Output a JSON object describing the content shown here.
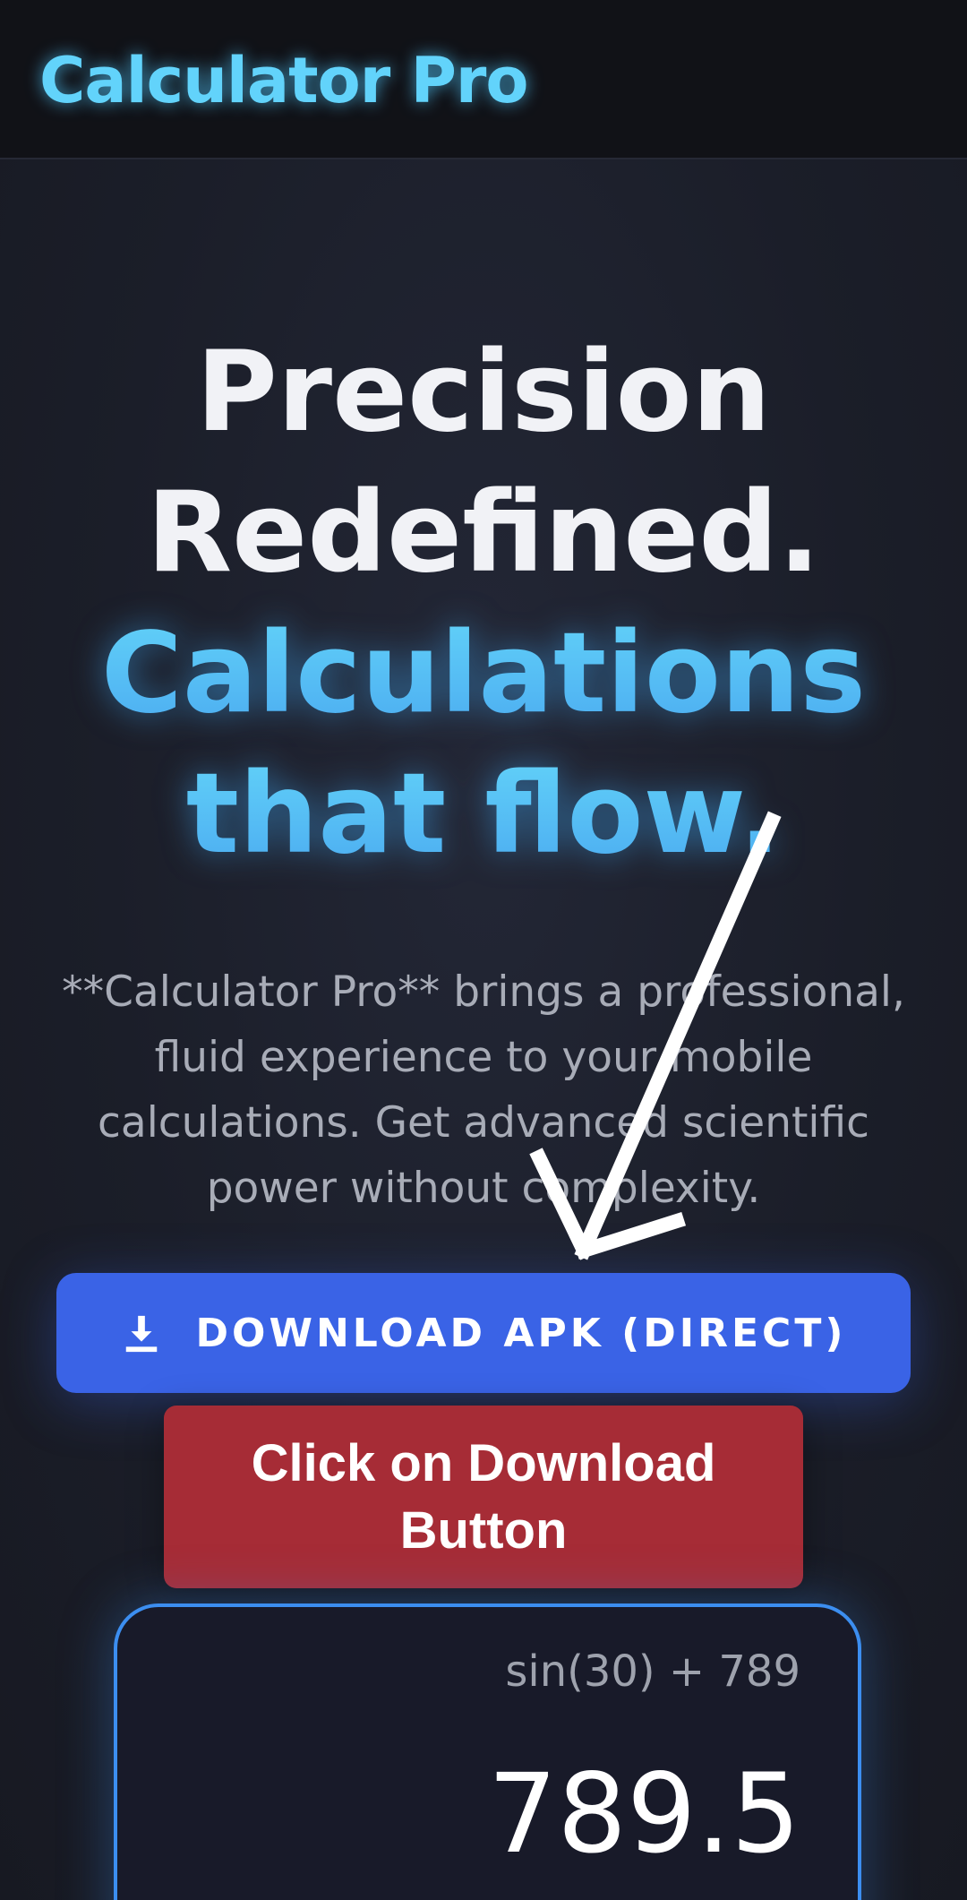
{
  "header": {
    "brand": "Calculator Pro"
  },
  "hero": {
    "line1": "Precision",
    "line2": "Redefined.",
    "line3": "Calculations",
    "line4": "that flow."
  },
  "description": "**Calculator Pro** brings a professional, fluid experience to your mobile calculations. Get advanced scientific power without complexity.",
  "download_button": {
    "label": "DOWNLOAD APK (DIRECT)",
    "icon": "download-icon"
  },
  "notice_button": {
    "label": "Click on Download Button"
  },
  "calculator_preview": {
    "expression": "sin(30) + 789",
    "result": "789.5"
  },
  "colors": {
    "accent": "#62d3fb",
    "download_button": "#3a63e6",
    "notice_button": "#a62c36",
    "card_border": "#3c8ef0"
  }
}
